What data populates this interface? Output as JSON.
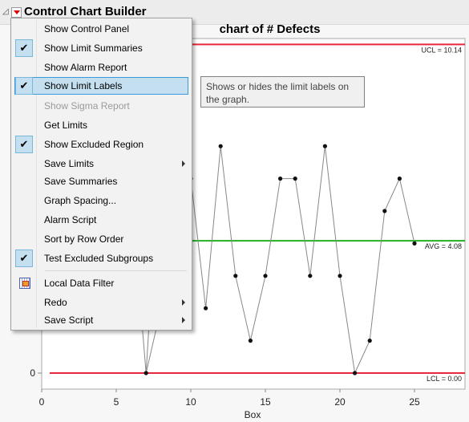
{
  "header": {
    "title": "Control Chart Builder"
  },
  "chart_data": {
    "type": "line",
    "title": "chart of # Defects",
    "xlabel": "Box",
    "ylabel": "",
    "xlim": [
      0,
      28.5
    ],
    "ylim": [
      -0.5,
      10.6
    ],
    "xticks": [
      "0",
      "5",
      "10",
      "15",
      "20",
      "25"
    ],
    "yticks": [
      "0"
    ],
    "x": [
      7,
      10,
      11,
      12,
      13,
      14,
      15,
      16,
      17,
      18,
      19,
      20,
      21,
      22,
      23,
      24,
      25
    ],
    "y": [
      0,
      6,
      2,
      7,
      3,
      1,
      3,
      6,
      6,
      3,
      7,
      3,
      0,
      1,
      5,
      6,
      4
    ],
    "limits": [
      {
        "label": "UCL = 10.14",
        "value": 10.14,
        "color": "#e8283c"
      },
      {
        "label": "AVG = 4.08",
        "value": 4.08,
        "color": "#22b022"
      },
      {
        "label": "LCL = 0.00",
        "value": 0,
        "color": "#e8283c"
      }
    ]
  },
  "menu": {
    "items": [
      {
        "label": "Show Control Panel"
      },
      {
        "label": "Show Limit Summaries",
        "checked": true
      },
      {
        "label": "Show Alarm Report"
      },
      {
        "label": "Show Limit Labels",
        "checked": true,
        "highlighted": true
      },
      {
        "label": "Show Sigma Report",
        "disabled": true
      },
      {
        "label": "Get Limits"
      },
      {
        "label": "Show Excluded Region",
        "checked": true
      },
      {
        "label": "Save Limits",
        "submenu": true
      },
      {
        "label": "Save Summaries"
      },
      {
        "label": "Graph Spacing..."
      },
      {
        "label": "Alarm Script"
      },
      {
        "label": "Sort by Row Order"
      },
      {
        "label": "Test Excluded Subgroups",
        "checked": true
      },
      {
        "label": "Local Data Filter",
        "icon": "data-filter-icon"
      },
      {
        "label": "Redo",
        "submenu": true
      },
      {
        "label": "Save Script",
        "submenu": true
      }
    ]
  },
  "tooltip": {
    "text": "Shows or hides the limit labels on the graph."
  }
}
